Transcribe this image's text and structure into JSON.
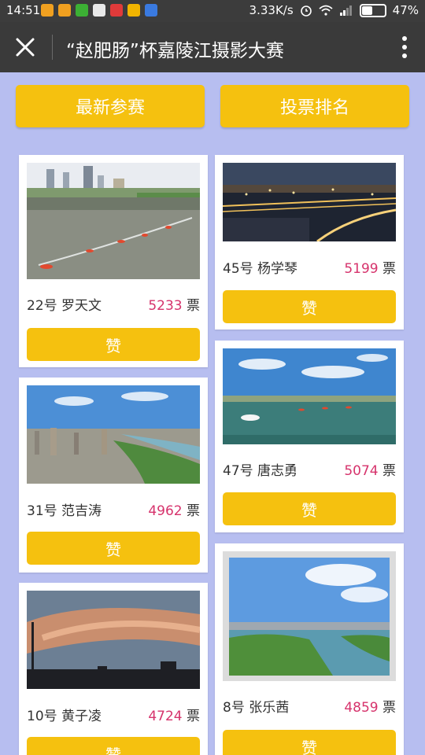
{
  "status_bar": {
    "time": "14:51",
    "speed": "3.33K/s",
    "battery": "47%"
  },
  "title_bar": {
    "title": "“赵肥肠”杯嘉陵江摄影大赛"
  },
  "tabs": {
    "latest": "最新参赛",
    "ranking": "投票排名"
  },
  "entries": [
    {
      "number": "22号",
      "name": "罗天文",
      "votes": "5233",
      "unit": "票",
      "like": "赞"
    },
    {
      "number": "45号",
      "name": "杨学琴",
      "votes": "5199",
      "unit": "票",
      "like": "赞"
    },
    {
      "number": "31号",
      "name": "范吉涛",
      "votes": "4962",
      "unit": "票",
      "like": "赞"
    },
    {
      "number": "47号",
      "name": "唐志勇",
      "votes": "5074",
      "unit": "票",
      "like": "赞"
    },
    {
      "number": "10号",
      "name": "黄子凌",
      "votes": "4724",
      "unit": "票",
      "like": "赞"
    },
    {
      "number": "8号",
      "name": "张乐茜",
      "votes": "4859",
      "unit": "票",
      "like": "赞"
    }
  ],
  "colors": {
    "background": "#b7bef0",
    "accent": "#f5c10f",
    "votes": "#d6336c"
  }
}
